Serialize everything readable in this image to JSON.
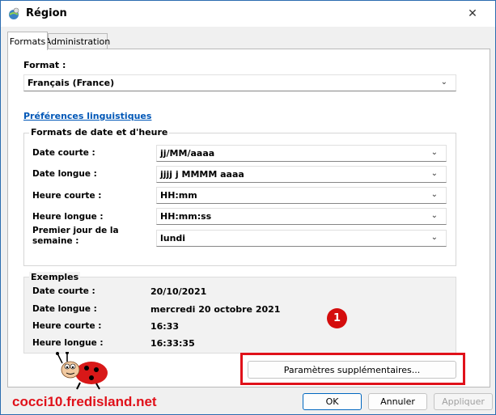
{
  "window": {
    "title": "Région"
  },
  "tabs": [
    {
      "label": "Formats",
      "active": true
    },
    {
      "label": "Administration",
      "active": false
    }
  ],
  "format": {
    "label": "Format :",
    "value": "Français (France)"
  },
  "prefs_link": "Préférences linguistiques",
  "date_time_group": {
    "title": "Formats de date et d'heure",
    "rows": [
      {
        "label": "Date courte :",
        "value": "jj/MM/aaaa"
      },
      {
        "label": "Date longue :",
        "value": "jjjj j MMMM aaaa"
      },
      {
        "label": "Heure courte :",
        "value": "HH:mm"
      },
      {
        "label": "Heure longue :",
        "value": "HH:mm:ss"
      },
      {
        "label": "Premier jour de la semaine :",
        "value": "lundi"
      }
    ]
  },
  "examples": {
    "title": "Exemples",
    "rows": [
      {
        "label": "Date courte :",
        "value": "20/10/2021"
      },
      {
        "label": "Date longue :",
        "value": "mercredi 20 octobre 2021"
      },
      {
        "label": "Heure courte :",
        "value": "16:33"
      },
      {
        "label": "Heure longue :",
        "value": "16:33:35"
      }
    ]
  },
  "badge": "1",
  "buttons": {
    "more_settings": "Paramètres supplémentaires...",
    "ok": "OK",
    "cancel": "Annuler",
    "apply": "Appliquer"
  },
  "watermark": "cocci10.fredisland.net",
  "icons": {
    "app": "region-globe-icon",
    "close": "close-icon",
    "chevron": "chevron-down-icon",
    "mascot": "ladybug-icon"
  },
  "colors": {
    "highlight": "#e0111a",
    "link": "#0057b7",
    "badge": "#d40d0d"
  }
}
